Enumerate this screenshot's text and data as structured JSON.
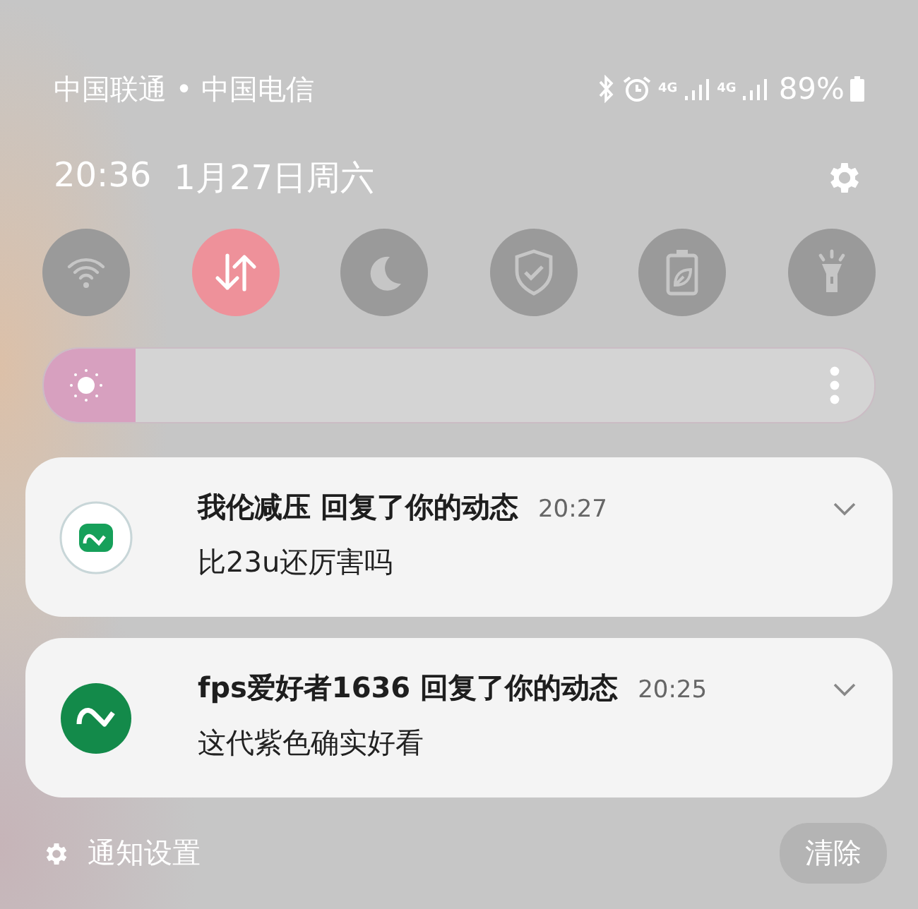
{
  "status_bar": {
    "carriers": "中国联通 • 中国电信",
    "battery": "89%",
    "network_labels": [
      "4G",
      "4G"
    ]
  },
  "header": {
    "time": "20:36",
    "date": "1月27日周六"
  },
  "quick_tiles": [
    {
      "kind": "wifi",
      "on": false
    },
    {
      "kind": "data",
      "on": true
    },
    {
      "kind": "moon",
      "on": false
    },
    {
      "kind": "shield",
      "on": false
    },
    {
      "kind": "battery",
      "on": false
    },
    {
      "kind": "flashlight",
      "on": false
    }
  ],
  "brightness": {
    "level": 0.11
  },
  "notifications": [
    {
      "sender": "我伦减压",
      "action": "回复了你的动态",
      "time": "20:27",
      "body": "比23u还厉害吗",
      "kind": "outline"
    },
    {
      "sender": "fps爱好者1636",
      "action": "回复了你的动态",
      "time": "20:25",
      "body": "这代紫色确实好看",
      "kind": "filled"
    }
  ],
  "footer": {
    "settings_label": "通知设置",
    "clear_button": "清除"
  }
}
